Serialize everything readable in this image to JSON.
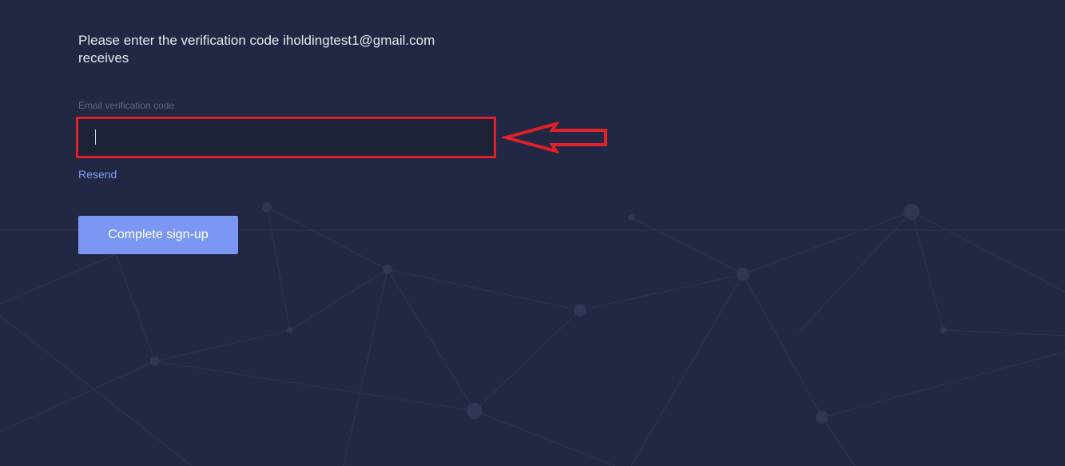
{
  "verification": {
    "instruction": "Please enter the verification code iholdingtest1@gmail.com receives",
    "field_label": "Email verification code",
    "code_value": "",
    "resend_label": "Resend",
    "submit_label": "Complete sign-up"
  },
  "colors": {
    "background": "#222843",
    "input_background": "#1e2236",
    "highlight_border": "#e0202a",
    "annotation_arrow": "#e0202a",
    "accent_button": "#7b97f3",
    "link": "#7f9cf5"
  },
  "icons": {
    "annotation": "arrow-left-icon"
  }
}
